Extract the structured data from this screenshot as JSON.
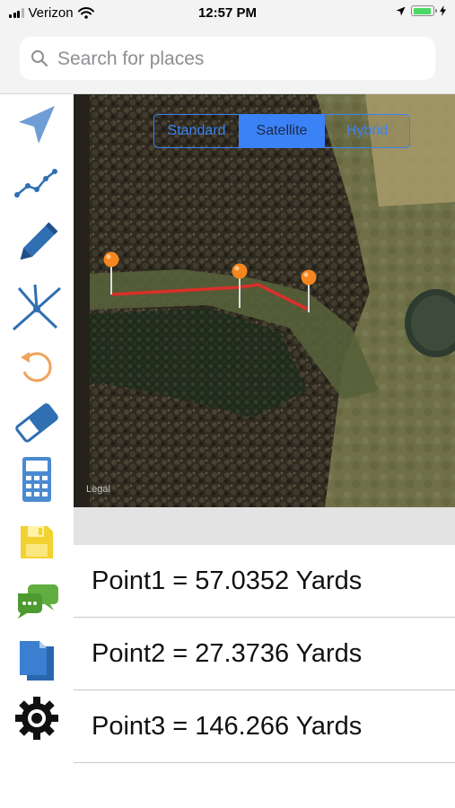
{
  "status_bar": {
    "carrier": "Verizon",
    "time": "12:57 PM",
    "battery_level": 0.95,
    "battery_color": "#4cd964"
  },
  "search": {
    "placeholder": "Search for places",
    "value": ""
  },
  "toolbar": {
    "items": [
      {
        "name": "location",
        "icon": "location-arrow-icon",
        "color": "#6f9ed6"
      },
      {
        "name": "path",
        "icon": "line-chart-icon",
        "color": "#2f6fb2"
      },
      {
        "name": "draw",
        "icon": "pencil-icon",
        "color": "#2f6fb2"
      },
      {
        "name": "measure",
        "icon": "compass-divider-icon",
        "color": "#2f6fb2"
      },
      {
        "name": "undo",
        "icon": "undo-icon",
        "color": "#f0a35a"
      },
      {
        "name": "erase",
        "icon": "eraser-icon",
        "color": "#2f6fb2"
      },
      {
        "name": "calculator",
        "icon": "calculator-icon",
        "color": "#4a8ad0"
      },
      {
        "name": "save",
        "icon": "floppy-disk-icon",
        "color": "#f2d230"
      },
      {
        "name": "chat",
        "icon": "chat-bubbles-icon",
        "color": "#5fae3f"
      },
      {
        "name": "documents",
        "icon": "documents-icon",
        "color": "#3b7fd0"
      },
      {
        "name": "settings",
        "icon": "gear-icon",
        "color": "#111111"
      }
    ]
  },
  "map": {
    "map_types": [
      "Standard",
      "Satellite",
      "Hybrid"
    ],
    "selected_map_type": "Satellite",
    "legal_label": "Legal",
    "route_color": "#d9302a",
    "pin_color": "#f5861f"
  },
  "results": [
    {
      "label": "Point1 = 57.0352 Yards"
    },
    {
      "label": "Point2 = 27.3736 Yards"
    },
    {
      "label": "Point3 = 146.266 Yards"
    }
  ],
  "accent_color": "#3b82f6"
}
